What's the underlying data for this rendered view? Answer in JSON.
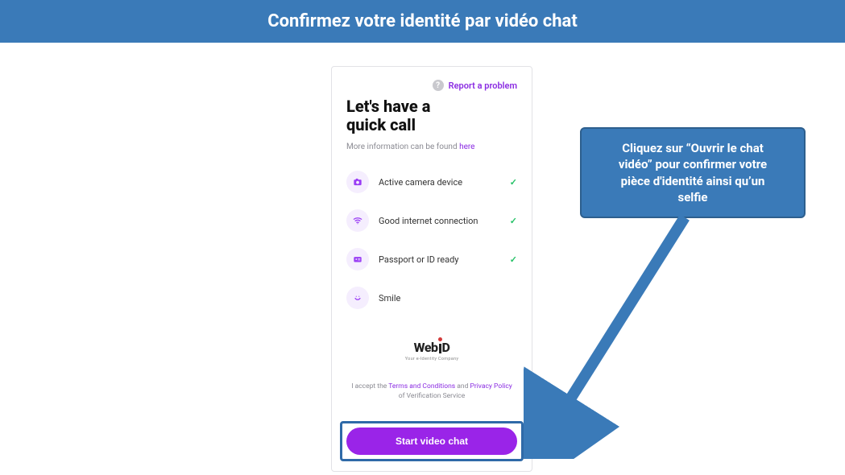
{
  "banner": {
    "title": "Confirmez votre identité par vidéo chat"
  },
  "top": {
    "help_icon_glyph": "?",
    "report_label": "Report a problem"
  },
  "heading": {
    "line1": "Let's have a",
    "line2": "quick call"
  },
  "more_info": {
    "prefix": "More information can be found ",
    "here": "here"
  },
  "rows": [
    {
      "label": "Active camera device",
      "tick": "✓"
    },
    {
      "label": "Good internet connection",
      "tick": "✓"
    },
    {
      "label": "Passport or ID ready",
      "tick": "✓"
    },
    {
      "label": "Smile",
      "tick": ""
    }
  ],
  "brand": {
    "name_left": "Web",
    "name_right": "D",
    "sub": "Your e-Identity Company"
  },
  "accept": {
    "prefix": "I accept the ",
    "terms": "Terms and Conditions",
    "and": " and ",
    "privacy": "Privacy Policy",
    "suffix": "of Verification Service"
  },
  "cta": {
    "label": "Start video chat"
  },
  "callout": {
    "line1": "Cliquez sur “Ouvrir le chat",
    "line2": "vidéo” pour confirmer votre",
    "line3": "pièce d'identité ainsi qu’un",
    "line4": "selfie"
  }
}
